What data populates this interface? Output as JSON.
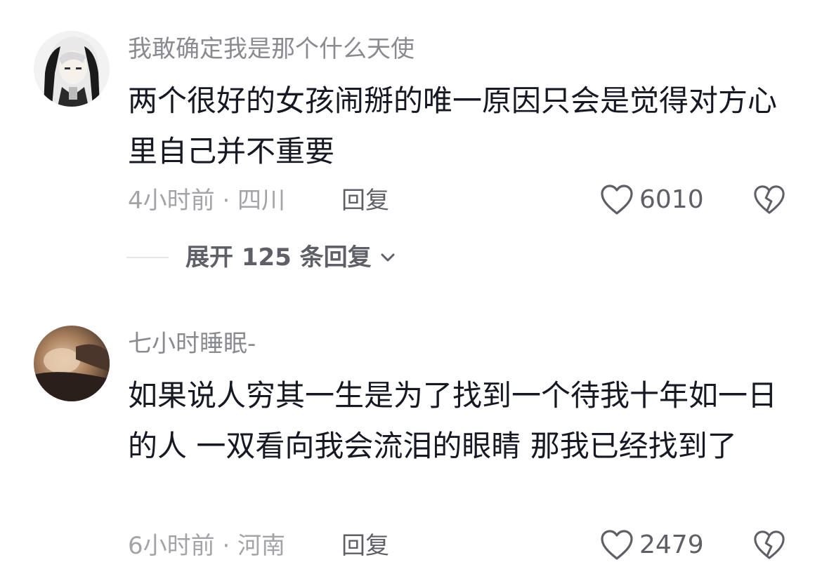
{
  "comments": [
    {
      "username": "我敢确定我是那个什么天使",
      "text": "两个很好的女孩闹掰的唯一原因只会是觉得对方心里自己并不重要",
      "time_location": "4小时前 · 四川",
      "reply_label": "回复",
      "likes": "6010",
      "like_icon": "heart-outline-icon",
      "dislike_icon": "broken-heart-icon",
      "expand_label": "展开 125 条回复"
    },
    {
      "username": "七小时睡眠-",
      "text": "如果说人穷其一生是为了找到一个待我十年如一日的人 一双看向我会流泪的眼睛 那我已经找到了",
      "time_location": "6小时前 · 河南",
      "reply_label": "回复",
      "likes": "2479",
      "like_icon": "heart-outline-icon",
      "dislike_icon": "broken-heart-icon"
    }
  ],
  "colors": {
    "text": "#161823",
    "secondary": "#8a8b91",
    "icon": "#5f6067"
  }
}
